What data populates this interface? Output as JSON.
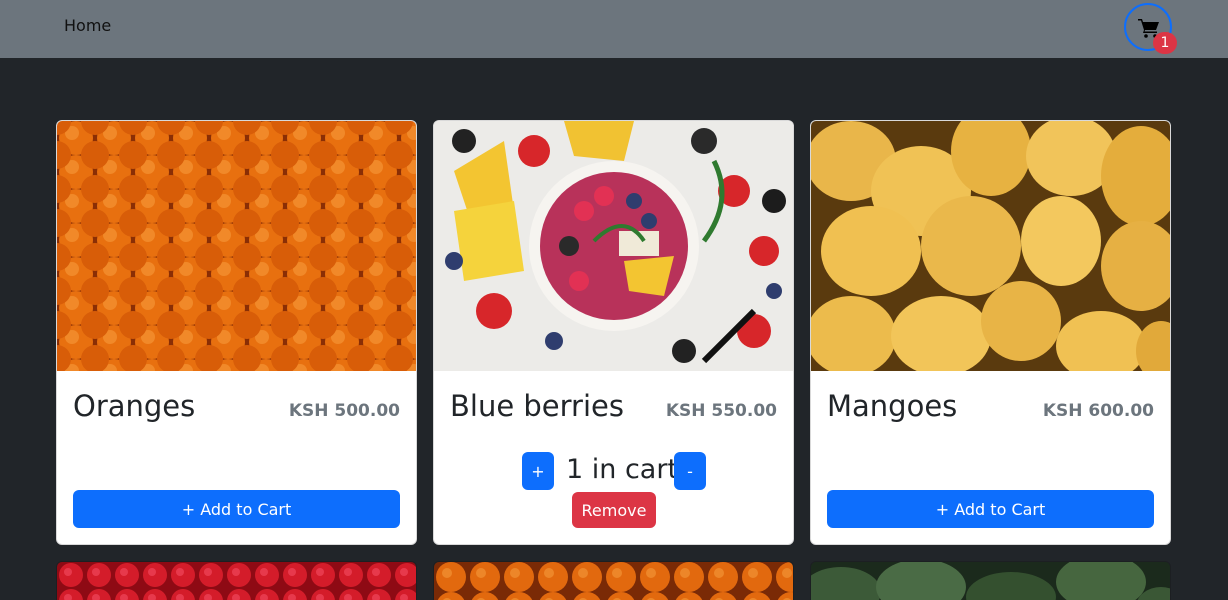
{
  "navbar": {
    "home_label": "Home",
    "cart_count": "1"
  },
  "products": [
    {
      "name": "Oranges",
      "price": "KSH 500.00",
      "add_label": "+ Add to Cart"
    },
    {
      "name": "Blue berries",
      "price": "KSH 550.00",
      "in_cart_label": "1 in cart",
      "plus_label": "+",
      "minus_label": "-",
      "remove_label": "Remove"
    },
    {
      "name": "Mangoes",
      "price": "KSH 600.00",
      "add_label": "+ Add to Cart"
    }
  ],
  "colors": {
    "primary": "#0d6efd",
    "danger": "#dc3545",
    "navbar": "#6c757d",
    "background": "#212529"
  }
}
